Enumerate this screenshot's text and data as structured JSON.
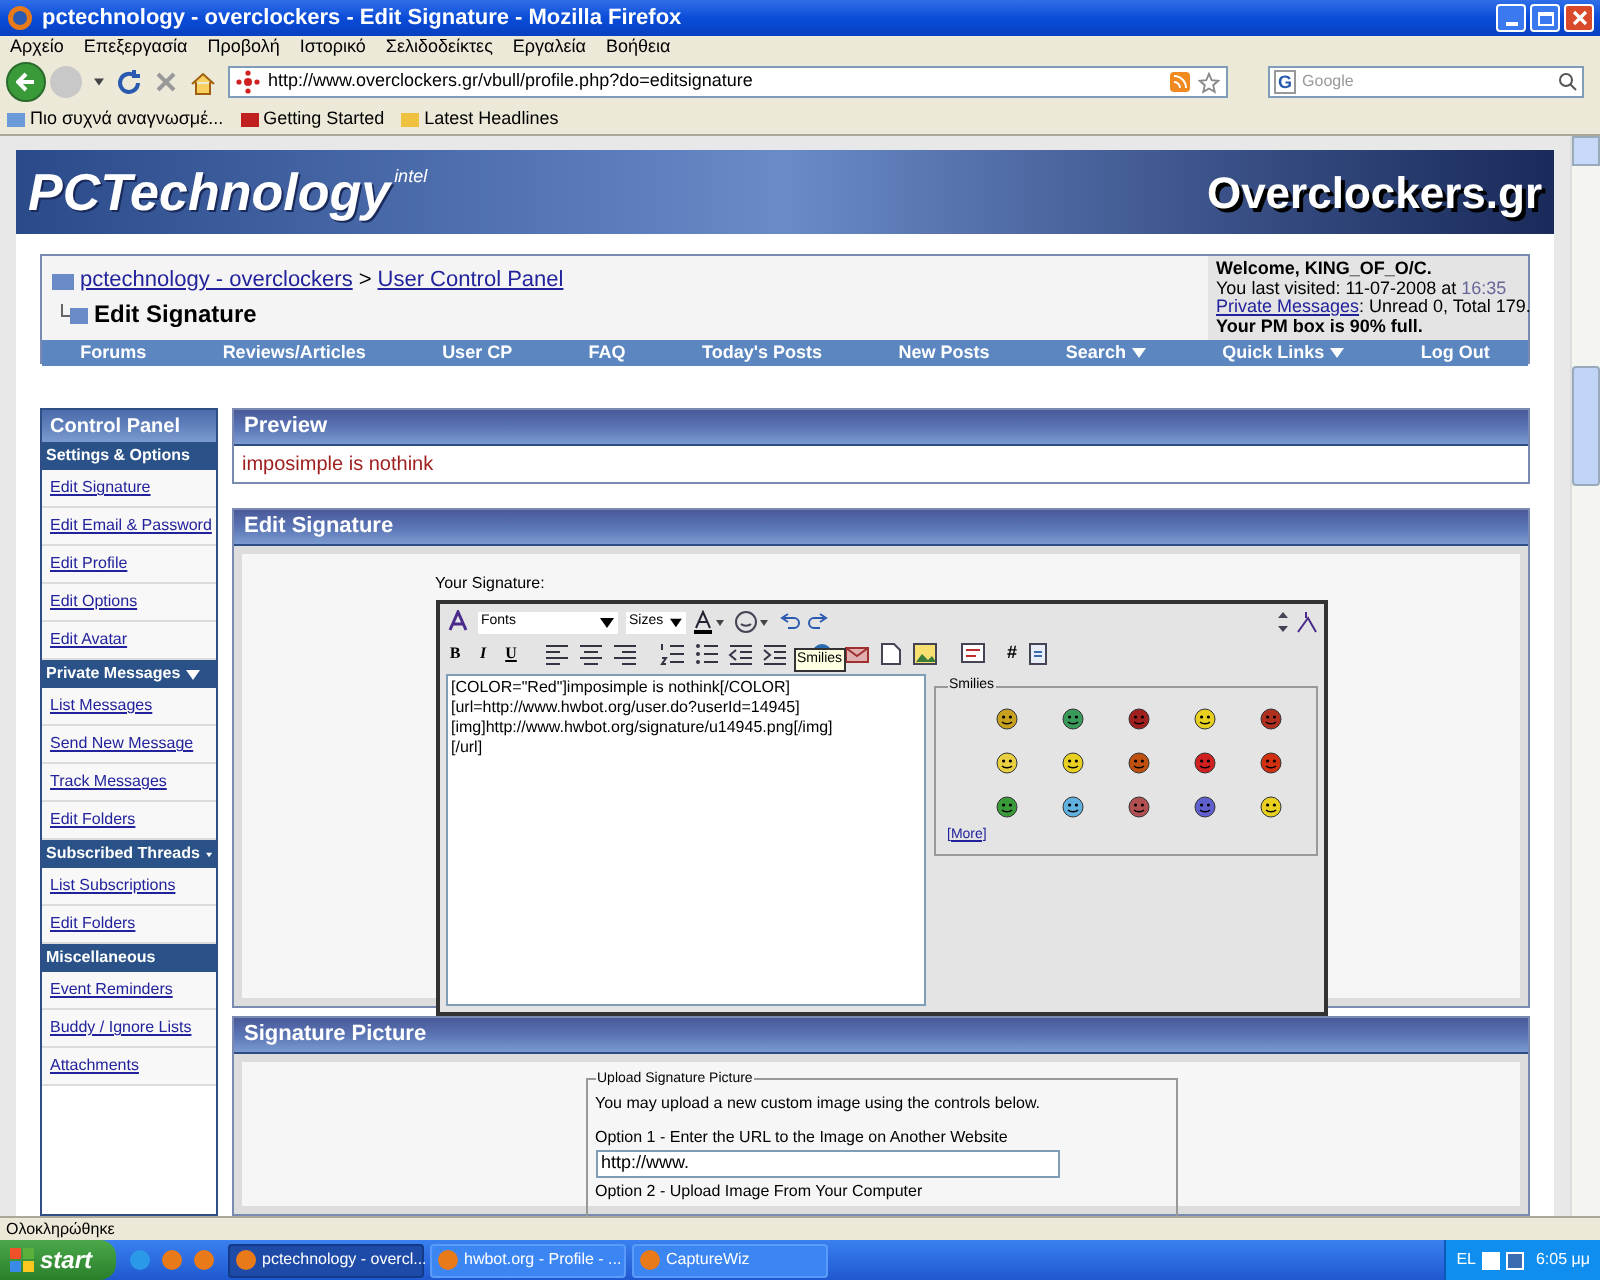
{
  "window": {
    "title": "pctechnology - overclockers - Edit Signature - Mozilla Firefox"
  },
  "menu": [
    "Αρχείο",
    "Επεξεργασία",
    "Προβολή",
    "Ιστορικό",
    "Σελιδοδείκτες",
    "Εργαλεία",
    "Βοήθεια"
  ],
  "address_bar": {
    "value": "http://www.overclockers.gr/vbull/profile.php?do=editsignature"
  },
  "search_field": {
    "engine": "G",
    "placeholder": "Google"
  },
  "bookmarks": [
    "Πιο συχνά αναγνωσμέ...",
    "Getting Started",
    "Latest Headlines"
  ],
  "banner": {
    "left_logo": "PCTechnology",
    "left_badge": "intel",
    "right_logo": "Overclockers.gr"
  },
  "breadcrumb": {
    "links": [
      "pctechnology - overclockers",
      "User Control Panel"
    ],
    "separator": ">",
    "current": "Edit Signature"
  },
  "welcome": {
    "greeting": "Welcome, KING_OF_O/C.",
    "last_visited": "You last visited: 11-07-2008 at",
    "time": "16:35",
    "pm_link": "Private Messages",
    "pm_counts": ": Unread 0, Total 179.",
    "pm_box": "Your PM box is 90% full."
  },
  "navbar": [
    {
      "label": "Forums",
      "dropdown": false
    },
    {
      "label": "Reviews/Articles",
      "dropdown": false
    },
    {
      "label": "User CP",
      "dropdown": false
    },
    {
      "label": "FAQ",
      "dropdown": false
    },
    {
      "label": "Today's Posts",
      "dropdown": false
    },
    {
      "label": "New Posts",
      "dropdown": false
    },
    {
      "label": "Search",
      "dropdown": true
    },
    {
      "label": "Quick Links",
      "dropdown": true
    },
    {
      "label": "Log Out",
      "dropdown": false
    }
  ],
  "sidebar": {
    "title": "Control Panel",
    "sections": [
      {
        "heading": "Settings & Options",
        "dropdown": false,
        "items": [
          "Edit Signature",
          "Edit Email & Password",
          "Edit Profile",
          "Edit Options",
          "Edit Avatar"
        ]
      },
      {
        "heading": "Private Messages",
        "dropdown": true,
        "items": [
          "List Messages",
          "Send New Message",
          "Track Messages",
          "Edit Folders"
        ]
      },
      {
        "heading": "Subscribed Threads",
        "dropdown": true,
        "items": [
          "List Subscriptions",
          "Edit Folders"
        ]
      },
      {
        "heading": "Miscellaneous",
        "dropdown": false,
        "items": [
          "Event Reminders",
          "Buddy / Ignore Lists",
          "Attachments"
        ]
      }
    ]
  },
  "preview": {
    "title": "Preview",
    "text": "imposimple is nothink"
  },
  "edit_signature": {
    "title": "Edit Signature",
    "label": "Your Signature:",
    "fonts": "Fonts",
    "sizes": "Sizes",
    "format_buttons": [
      "B",
      "I",
      "U"
    ],
    "code_button": "#",
    "tooltip": "Smilies",
    "lines": [
      "[COLOR=\"Red\"]imposimple is nothink[/COLOR]",
      "[url=http://www.hwbot.org/user.do?userId=14945]",
      "[img]http://www.hwbot.org/signature/u14945.png[/img]",
      "[/url]"
    ],
    "smilies_title": "Smilies",
    "more_link": "[More]"
  },
  "signature_picture": {
    "title": "Signature Picture",
    "legend": "Upload Signature Picture",
    "intro": "You may upload a new custom image using the controls below.",
    "option1": "Option 1 - Enter the URL to the Image on Another Website",
    "url_value": "http://www.",
    "option2": "Option 2 - Upload Image From Your Computer"
  },
  "status_bar": "Ολοκληρώθηκε",
  "taskbar": {
    "start": "start",
    "tasks": [
      {
        "label": "pctechnology - overcl...",
        "selected": true
      },
      {
        "label": "hwbot.org - Profile - ...",
        "selected": false
      },
      {
        "label": "CaptureWiz",
        "selected": false
      }
    ],
    "language": "EL",
    "clock": "6:05 μμ"
  }
}
